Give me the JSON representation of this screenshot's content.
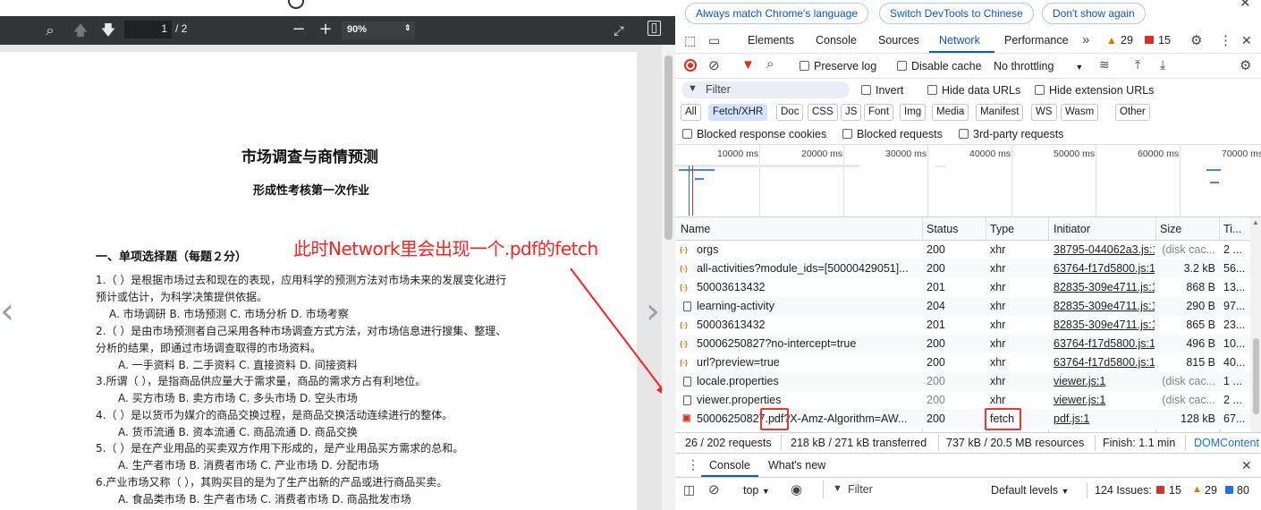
{
  "pdf_viewer": {
    "page_current": "1",
    "page_total": "/ 2",
    "zoom": "90%",
    "search_icon": "search-icon",
    "prev_icon": "arrow-up-icon",
    "next_icon": "arrow-down-icon",
    "zoom_out": "−",
    "zoom_in": "+",
    "fit_icon": "fit-page-icon",
    "sidebar_icon": "sidebar-icon"
  },
  "document": {
    "title": "市场调查与商情预测",
    "subtitle": "形成性考核第一次作业",
    "section": "一、单项选择题（每题２分）",
    "lines": [
      "1.（  ）是根据市场过去和现在的表现，应用科学的预测方法对市场未来的发展变化进行",
      "预计或估计，为科学决策提供依据。",
      "A. 市场调研   B. 市场预测   C. 市场分析   D. 市场考察",
      "2.（  ）是由市场预测者自己采用各种市场调查方式方法，对市场信息进行搜集、整理、",
      "分析的结果，即通过市场调查取得的市场资料。",
      "A. 一手资料   B. 二手资料   C. 直接资料   D. 间接资料",
      "3.所谓（  ），是指商品供应量大于需求量，商品的需求方占有利地位。",
      "A. 买方市场   B. 卖方市场   C. 多头市场   D. 空头市场",
      "4.（  ）是以货币为媒介的商品交换过程，是商品交换活动连续进行的整体。",
      "A. 货币流通   B. 资本流通   C. 商品流通   D. 商品交换",
      "5.（  ）是在产业用品的买卖双方作用下形成的，是产业用品买方需求的总和。",
      "A. 生产者市场 B. 消费者市场  C. 产业市场   D. 分配市场",
      "6.产业市场又称（  ），其购买目的是为了生产出新的产品或进行商品买卖。",
      "A. 食品类市场     B. 生产者市场   C. 消费者市场   D. 商品批发市场"
    ],
    "annotation": "此时Network里会出现一个.pdf的fetch"
  },
  "devtools": {
    "banner": [
      "Always match Chrome's language",
      "Switch DevTools to Chinese",
      "Don't show again"
    ],
    "tabs": [
      "Elements",
      "Console",
      "Sources",
      "Network",
      "Performance"
    ],
    "active_tab": "Network",
    "warnings": "29",
    "errors": "15",
    "preserve_log": "Preserve log",
    "disable_cache": "Disable cache",
    "throttling": "No throttling",
    "filter_placeholder": "Filter",
    "invert": "Invert",
    "hide_data_urls": "Hide data URLs",
    "hide_ext_urls": "Hide extension URLs",
    "type_filters": [
      "All",
      "Fetch/XHR",
      "Doc",
      "CSS",
      "JS",
      "Font",
      "Img",
      "Media",
      "Manifest",
      "WS",
      "Wasm",
      "Other"
    ],
    "active_type_filter": "Fetch/XHR",
    "blocked_cookies": "Blocked response cookies",
    "blocked_requests": "Blocked requests",
    "third_party": "3rd-party requests",
    "timeline_ticks": [
      "10000 ms",
      "20000 ms",
      "30000 ms",
      "40000 ms",
      "50000 ms",
      "60000 ms",
      "70000 ms"
    ],
    "columns": [
      "Name",
      "Status",
      "Type",
      "Initiator",
      "Size",
      "Ti..."
    ],
    "rows": [
      {
        "name": "orgs",
        "status": "200",
        "type": "xhr",
        "initiator": "38795-044062a3.js:1",
        "size": "(disk cac...",
        "time": "2 ...",
        "icon": "xhr",
        "muted": false
      },
      {
        "name": "all-activities?module_ids=[50000429051]...",
        "status": "200",
        "type": "xhr",
        "initiator": "63764-f17d5800.js:1",
        "size": "3.2 kB",
        "time": "56...",
        "icon": "xhr",
        "muted": false
      },
      {
        "name": "50003613432",
        "status": "201",
        "type": "xhr",
        "initiator": "82835-309e4711.js:1",
        "size": "868 B",
        "time": "13...",
        "icon": "xhr",
        "muted": false
      },
      {
        "name": "learning-activity",
        "status": "204",
        "type": "xhr",
        "initiator": "82835-309e4711.js:1",
        "size": "290 B",
        "time": "97...",
        "icon": "doc",
        "muted": false
      },
      {
        "name": "50003613432",
        "status": "201",
        "type": "xhr",
        "initiator": "82835-309e4711.js:1",
        "size": "865 B",
        "time": "23...",
        "icon": "xhr",
        "muted": false
      },
      {
        "name": "50006250827?no-intercept=true",
        "status": "200",
        "type": "xhr",
        "initiator": "63764-f17d5800.js:1",
        "size": "496 B",
        "time": "10...",
        "icon": "xhr",
        "muted": false
      },
      {
        "name": "url?preview=true",
        "status": "200",
        "type": "xhr",
        "initiator": "63764-f17d5800.js:1",
        "size": "815 B",
        "time": "40...",
        "icon": "xhr",
        "muted": false
      },
      {
        "name": "locale.properties",
        "status": "200",
        "type": "xhr",
        "initiator": "viewer.js:1",
        "size": "(disk cac...",
        "time": "1 ...",
        "icon": "doc",
        "muted": true
      },
      {
        "name": "viewer.properties",
        "status": "200",
        "type": "xhr",
        "initiator": "viewer.js:1",
        "size": "(disk cac...",
        "time": "2 ...",
        "icon": "doc",
        "muted": true
      },
      {
        "name": "50006250827.pdf?X-Amz-Algorithm=AW...",
        "status": "200",
        "type": "fetch",
        "initiator": "pdf.js:1",
        "size": "128 kB",
        "time": "67...",
        "icon": "pdf",
        "muted": false
      }
    ],
    "summary": [
      "26 / 202 requests",
      "218 kB / 271 kB transferred",
      "737 kB / 20.5 MB resources",
      "Finish: 1.1 min",
      "DOMContent"
    ],
    "drawer_tabs": [
      "Console",
      "What's new"
    ],
    "console_context": "top",
    "console_filter": "Filter",
    "default_levels": "Default levels",
    "issues": "124 Issues:",
    "issues_errors": "15",
    "issues_warnings": "29",
    "issues_info": "80",
    "colors": {
      "accent": "#1a73e8",
      "error": "#d93025",
      "warning": "#e37400",
      "annotation": "#ff2020"
    }
  }
}
